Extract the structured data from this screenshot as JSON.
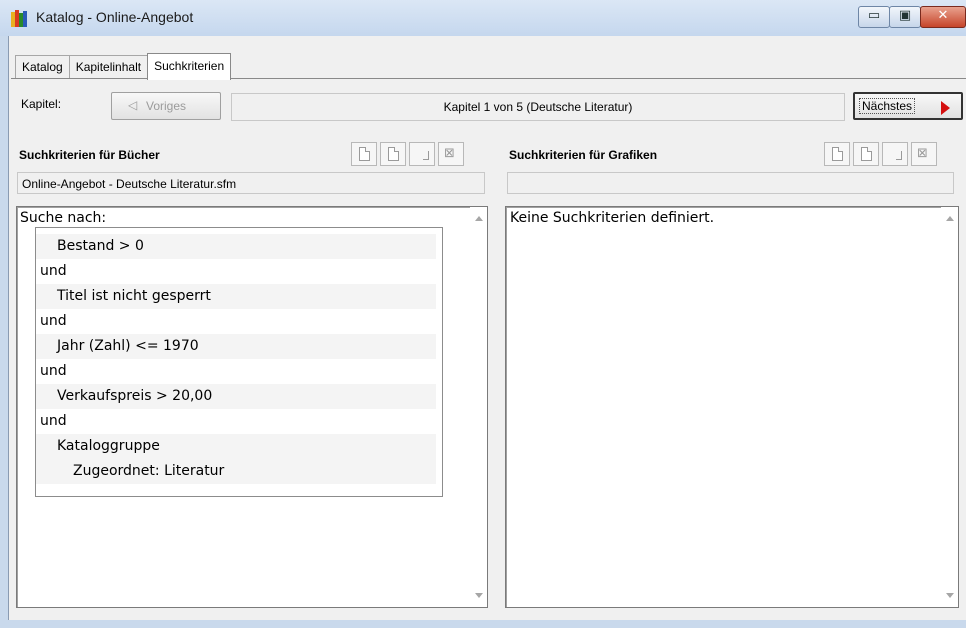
{
  "window": {
    "title": "Katalog - Online-Angebot"
  },
  "caption": {
    "minimize": "▭",
    "maximize": "▣",
    "close": "✕"
  },
  "tabs": [
    {
      "label": "Katalog"
    },
    {
      "label": "Kapitelinhalt"
    },
    {
      "label": "Suchkriterien"
    }
  ],
  "chapter": {
    "label": "Kapitel:",
    "prev_label": "Voriges",
    "status": "Kapitel 1 von 5 (Deutsche Literatur)",
    "next_label": "Nächstes"
  },
  "books": {
    "title": "Suchkriterien für Bücher",
    "file": "Online-Angebot - Deutsche Literatur.sfm",
    "heading": "Suche nach:",
    "lines": [
      "Bestand > 0",
      "und",
      "Titel ist nicht gesperrt",
      "und",
      "Jahr (Zahl) <= 1970",
      "und",
      "Verkaufspreis > 20,00",
      "und",
      "Kataloggruppe",
      "Zugeordnet: Literatur"
    ]
  },
  "graphics": {
    "title": "Suchkriterien für Grafiken",
    "file": "",
    "empty_text": "Keine Suchkriterien definiert."
  }
}
